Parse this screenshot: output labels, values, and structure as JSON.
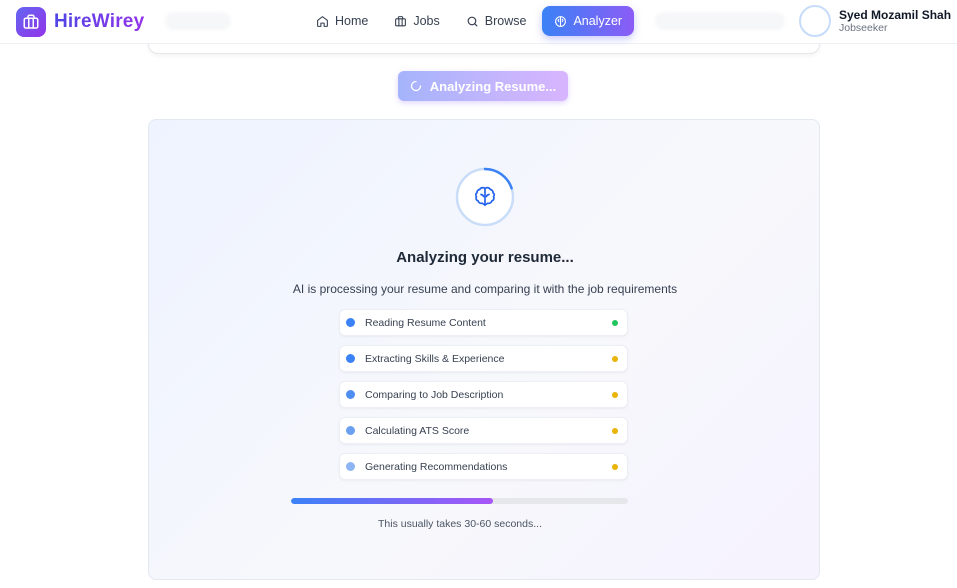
{
  "header": {
    "brand": "HireWirey",
    "brand_icon": "briefcase-icon",
    "nav": [
      {
        "label": "Home",
        "icon": "home-icon",
        "active": false
      },
      {
        "label": "Jobs",
        "icon": "briefcase-icon",
        "active": false
      },
      {
        "label": "Browse",
        "icon": "search-icon",
        "active": false
      },
      {
        "label": "Analyzer",
        "icon": "brain-icon",
        "active": true
      }
    ],
    "user": {
      "name": "Syed Mozamil Shah",
      "role": "Jobseeker"
    }
  },
  "analyze_button": {
    "label": "Analyzing Resume...",
    "icon": "loader-icon"
  },
  "panel": {
    "icon": "brain-icon",
    "title": "Analyzing your resume...",
    "subtitle": "AI is processing your resume and comparing it with the job requirements",
    "steps": [
      {
        "label": "Reading Resume Content",
        "dot_color": "#3b82f6",
        "status_color": "#22c55e"
      },
      {
        "label": "Extracting Skills & Experience",
        "dot_color": "#3b82f6",
        "status_color": "#eab308"
      },
      {
        "label": "Comparing to Job Description",
        "dot_color": "#4f8ef0",
        "status_color": "#eab308"
      },
      {
        "label": "Calculating ATS Score",
        "dot_color": "#6b9ff0",
        "status_color": "#eab308"
      },
      {
        "label": "Generating Recommendations",
        "dot_color": "#8db4f3",
        "status_color": "#eab308"
      }
    ],
    "progress_percent": 60,
    "note": "This usually takes 30-60 seconds..."
  },
  "colors": {
    "accent_start": "#3b82f6",
    "accent_end": "#8b5cf6",
    "brand_start": "#4f46e5",
    "brand_end": "#9333ea"
  }
}
